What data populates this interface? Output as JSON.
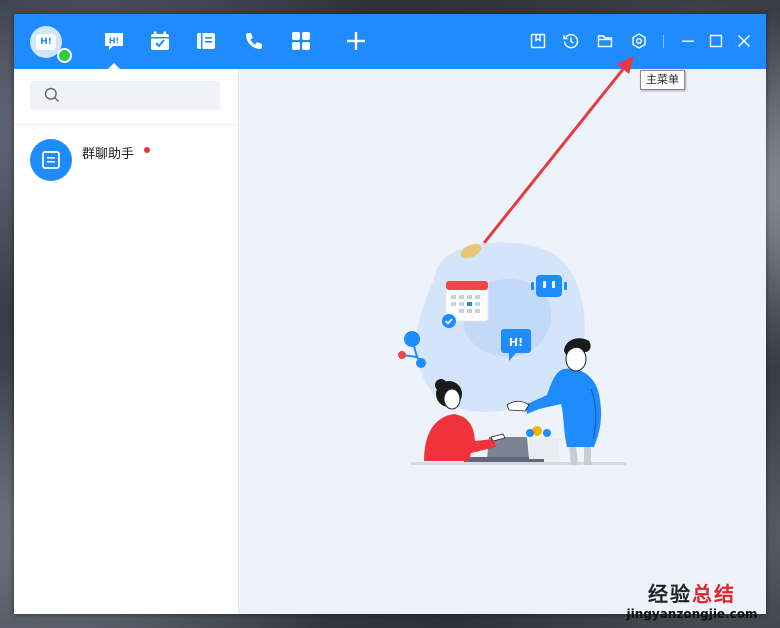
{
  "window": {
    "app_logo_text": "H!"
  },
  "nav_tabs": [
    {
      "id": "messages",
      "icon": "chat-bubble-icon",
      "active": true
    },
    {
      "id": "calendar",
      "icon": "calendar-check-icon",
      "active": false
    },
    {
      "id": "docs",
      "icon": "document-icon",
      "active": false
    },
    {
      "id": "phone",
      "icon": "phone-icon",
      "active": false
    },
    {
      "id": "apps",
      "icon": "grid-icon",
      "active": false
    },
    {
      "id": "add",
      "icon": "plus-icon",
      "active": false
    }
  ],
  "toolbar": {
    "buttons": [
      "bookmark-icon",
      "history-icon",
      "folder-icon",
      "settings-icon"
    ],
    "window_controls": [
      "minimize-icon",
      "maximize-icon",
      "close-icon"
    ]
  },
  "search": {
    "placeholder": "",
    "value": ""
  },
  "conversations": [
    {
      "name": "群聊助手",
      "unread": true,
      "icon": "group-assistant-icon"
    }
  ],
  "tooltip": {
    "text": "主菜单"
  },
  "watermark": {
    "title_a": "经验",
    "title_b": "总结",
    "url": "jingyanzongjie.com"
  },
  "colors": {
    "brand_blue": "#1e8bff",
    "unread_red": "#f0323c",
    "online_green": "#2ecc40",
    "annotation_red": "#e8393f"
  }
}
